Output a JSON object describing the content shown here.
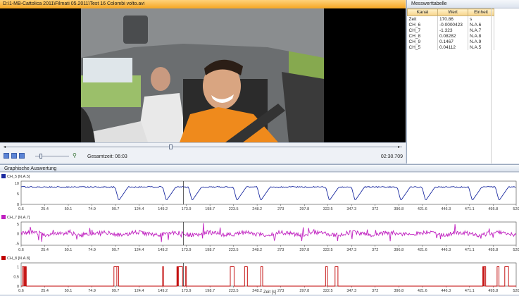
{
  "window": {
    "title": "D:\\1-MB-Cattolica 2011\\Filmati 05.2011\\Test 16 Colombi volto.avi"
  },
  "player": {
    "gesamtzeit_label": "Gesamtzeit: 06:03",
    "current_time": "02:30.709",
    "position": 0.415
  },
  "messwert": {
    "title": "Messwerttabelle",
    "columns": [
      "Kanal",
      "Wert",
      "Einheit"
    ],
    "rows": [
      [
        "Zeit",
        "170.86",
        "s"
      ],
      [
        "CH_6",
        "-0.0000423",
        "N.A.6"
      ],
      [
        "CH_7",
        "-1.323",
        "N.A.7"
      ],
      [
        "CH_8",
        "0.08282",
        "N.A.8"
      ],
      [
        "CH_9",
        "0.1467",
        "N.A.9"
      ],
      [
        "CH_5",
        "0.04112",
        "N.A.5"
      ]
    ]
  },
  "graph": {
    "title": "Graphische Auswertung",
    "xlabel": "Zeit [s]"
  },
  "colors": {
    "ch5": "#1a2aa0",
    "ch7": "#c020c0",
    "ch8": "#c00000"
  },
  "chart_data": [
    {
      "type": "line",
      "title": "CH_5 [N.A.5]",
      "series": [
        {
          "name": "CH_5 [N.A.5]",
          "color": "#1a2aa0"
        }
      ],
      "xticks": [
        "0.6",
        "25.4",
        "50.1",
        "74.9",
        "99.7",
        "124.4",
        "149.2",
        "173.9",
        "198.7",
        "223.5",
        "248.2",
        "273",
        "297.8",
        "322.5",
        "347.3",
        "372",
        "396.8",
        "421.6",
        "446.3",
        "471.1",
        "495.8",
        "520"
      ],
      "yticks": [
        "0",
        "5",
        "10"
      ],
      "ylim": [
        0,
        11
      ],
      "xlim": [
        0.6,
        520
      ],
      "cursor_x": 170.86,
      "pattern": "sawtooth",
      "dips_at": [
        99,
        149,
        176,
        223,
        248,
        320,
        347,
        395,
        421,
        470,
        498
      ]
    },
    {
      "type": "line",
      "title": "CH_7 [N.A.7]",
      "series": [
        {
          "name": "CH_7 [N.A.7]",
          "color": "#c020c0"
        }
      ],
      "xticks": [
        "0.6",
        "25.4",
        "50.1",
        "74.9",
        "99.7",
        "124.4",
        "149.2",
        "173.9",
        "198.7",
        "223.5",
        "248.2",
        "273",
        "297.8",
        "322.5",
        "347.3",
        "372",
        "396.8",
        "421.6",
        "446.3",
        "471.1",
        "495.8",
        "520"
      ],
      "yticks": [
        "-5",
        "0",
        "5"
      ],
      "ylim": [
        -6,
        6
      ],
      "xlim": [
        0.6,
        520
      ],
      "cursor_x": 170.86,
      "pattern": "noise"
    },
    {
      "type": "line",
      "title": "CH_8 [N.A.8]",
      "series": [
        {
          "name": "CH_8 [N.A.8]",
          "color": "#c00000"
        }
      ],
      "xticks": [
        "0.6",
        "25.4",
        "50.1",
        "74.9",
        "99.7",
        "124.4",
        "149.2",
        "173.9",
        "198.7",
        "223.5",
        "248.2",
        "273",
        "297.8",
        "322.5",
        "347.3",
        "372",
        "396.8",
        "421.6",
        "446.3",
        "471.1",
        "495.8",
        "520"
      ],
      "yticks": [
        "0",
        "0.5",
        "1"
      ],
      "ylim": [
        0,
        1.2
      ],
      "xlim": [
        0.6,
        520
      ],
      "cursor_x": 170.86,
      "pattern": "pulses",
      "pulses": [
        [
          2,
          6
        ],
        [
          98,
          101
        ],
        [
          101,
          103
        ],
        [
          149,
          150
        ],
        [
          164,
          170
        ],
        [
          173,
          174
        ],
        [
          220,
          224
        ],
        [
          235,
          238
        ],
        [
          252,
          254
        ],
        [
          320,
          322
        ],
        [
          330,
          333
        ],
        [
          485,
          488
        ],
        [
          500,
          502
        ],
        [
          508,
          512
        ]
      ]
    }
  ]
}
